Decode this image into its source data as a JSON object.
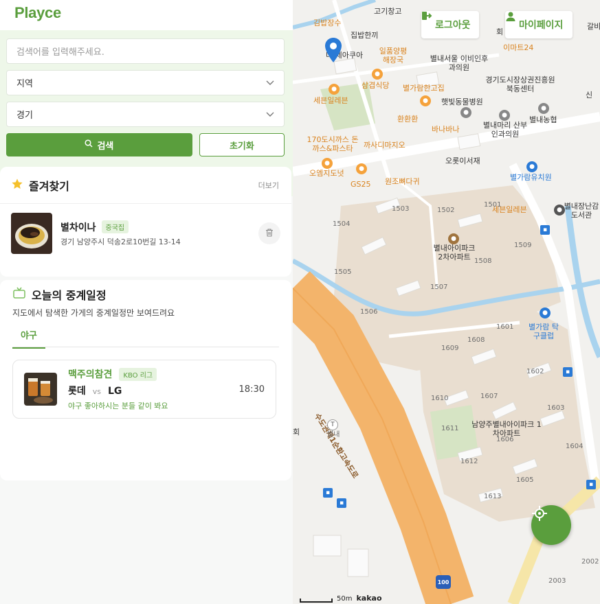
{
  "brand": "Playce",
  "search": {
    "placeholder": "검색어를 입력해주세요.",
    "region": "지역",
    "region2": "경기",
    "search_label": "검색",
    "reset_label": "초기화"
  },
  "favorites": {
    "title": "즐겨찾기",
    "more": "더보기",
    "items": [
      {
        "name": "별차이나",
        "tag": "중국집",
        "address": "경기 남양주시 덕송2로10번길 13-14"
      }
    ]
  },
  "schedule": {
    "title": "오늘의 중계일정",
    "subtitle": "지도에서 탐색한 가게의 중계일정만 보여드려요",
    "tab": "야구",
    "match": {
      "place": "맥주의참견",
      "league": "KBO 리그",
      "home": "롯데",
      "vs": "vs",
      "away": "LG",
      "note": "야구 좋아하시는 분들 같이 봐요",
      "time": "18:30"
    }
  },
  "map": {
    "logout": "로그아웃",
    "mypage": "마이페이지",
    "scale": "50m",
    "provider": "kakao",
    "labels": [
      "고기창고",
      "김밥장수",
      "집밥한끼",
      "더 제아쿠아",
      "일품양평해장국",
      "별내서울 이비인후과의원",
      "이마트24",
      "경기도시장상권진흥원 북동센터",
      "삼겹식당",
      "별가람한고집",
      "세븐일레븐",
      "햇빛동물병원",
      "환환환",
      "바나바나",
      "별내마리 산부인과의원",
      "별내농협",
      "170도시까스 돈까스&파스타",
      "까사디마지오",
      "오롯이서재",
      "오엠지도넛",
      "GS25",
      "원조뼈다귀",
      "별가람유치원",
      "세븐일레븐",
      "별내장난감 도서관",
      "별내아이파크 2차아파트",
      "별가람 탁구클럽",
      "남양주별내아이파크 1차아파트",
      "수도권제1순환고속도로",
      "별내"
    ],
    "buildings": [
      "1501",
      "1502",
      "1503",
      "1504",
      "1505",
      "1506",
      "1507",
      "1508",
      "1509",
      "1601",
      "1602",
      "1603",
      "1604",
      "1605",
      "1606",
      "1607",
      "1608",
      "1609",
      "1610",
      "1611",
      "1612",
      "1613",
      "2002",
      "2003"
    ],
    "road_badge": "100",
    "edge_text": [
      "신",
      "갈비",
      "회",
      "회"
    ]
  },
  "colors": {
    "accent": "#5a9e3d",
    "highway": "#f3b46b",
    "park": "#d6e4c4"
  }
}
